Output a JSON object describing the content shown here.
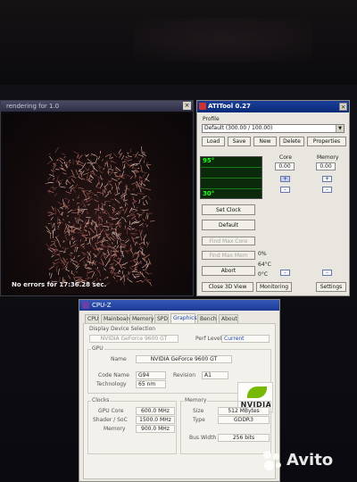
{
  "colors": {
    "graph_bg": "#0b2a0b",
    "graph_text": "#22ff22",
    "titlebar_blue": "#1a3f9a",
    "nvidia_green": "#76b900"
  },
  "render_window": {
    "title": "rendering for 1.0",
    "close_glyph": "×",
    "status": "No errors for 17:36.28 sec."
  },
  "atitool": {
    "title": "ATITool 0.27",
    "close_glyph": "×",
    "profile_label": "Profile",
    "profile_value": "Default (300.00 / 100.00)",
    "buttons": {
      "load": "Load",
      "save": "Save",
      "new": "New",
      "delete": "Delete",
      "properties": "Properties"
    },
    "core_label": "Core",
    "memory_label": "Memory",
    "core_value": "0.00",
    "memory_value": "0.00",
    "graph_top": "95°",
    "graph_bottom": "30°",
    "set_clock": "Set Clock",
    "default": "Default",
    "find_max_core": "Find Max Core",
    "find_max_mem": "Find Max Mem",
    "abort": "Abort",
    "close_3d_view": "Close 3D View",
    "monitoring": "Monitoring",
    "settings": "Settings",
    "percent": "0%",
    "temp1": "64°C",
    "temp2": "0°C"
  },
  "cpuz": {
    "title": "CPU-Z",
    "tabs": [
      "CPU",
      "Mainboard",
      "Memory",
      "SPD",
      "Graphics",
      "Bench",
      "About"
    ],
    "selected_tab": "Graphics",
    "display_device_label": "Display Device Selection",
    "device_value": "NVIDIA GeForce 9600 GT",
    "perf_level_label": "Perf Level",
    "perf_level_value": "Current",
    "gpu_label": "GPU",
    "name_label": "Name",
    "name_value": "NVIDIA GeForce 9600 GT",
    "code_name_label": "Code Name",
    "code_name_value": "G94",
    "revision_label": "Revision",
    "revision_value": "A1",
    "technology_label": "Technology",
    "technology_value": "65 nm",
    "clocks_label": "Clocks",
    "gpu_core_label": "GPU Core",
    "gpu_core_value": "600.0 MHz",
    "shader_label": "Shader / SoC",
    "shader_value": "1500.0 MHz",
    "mem_clock_label": "Memory",
    "mem_clock_value": "900.0 MHz",
    "memory_label": "Memory",
    "size_label": "Size",
    "size_value": "512 MBytes",
    "type_label": "Type",
    "type_value": "GDDR3",
    "bus_width_label": "Bus Width",
    "bus_width_value": "256 bits",
    "logo_text": "NVIDIA"
  },
  "watermark": {
    "text": "Avito"
  }
}
